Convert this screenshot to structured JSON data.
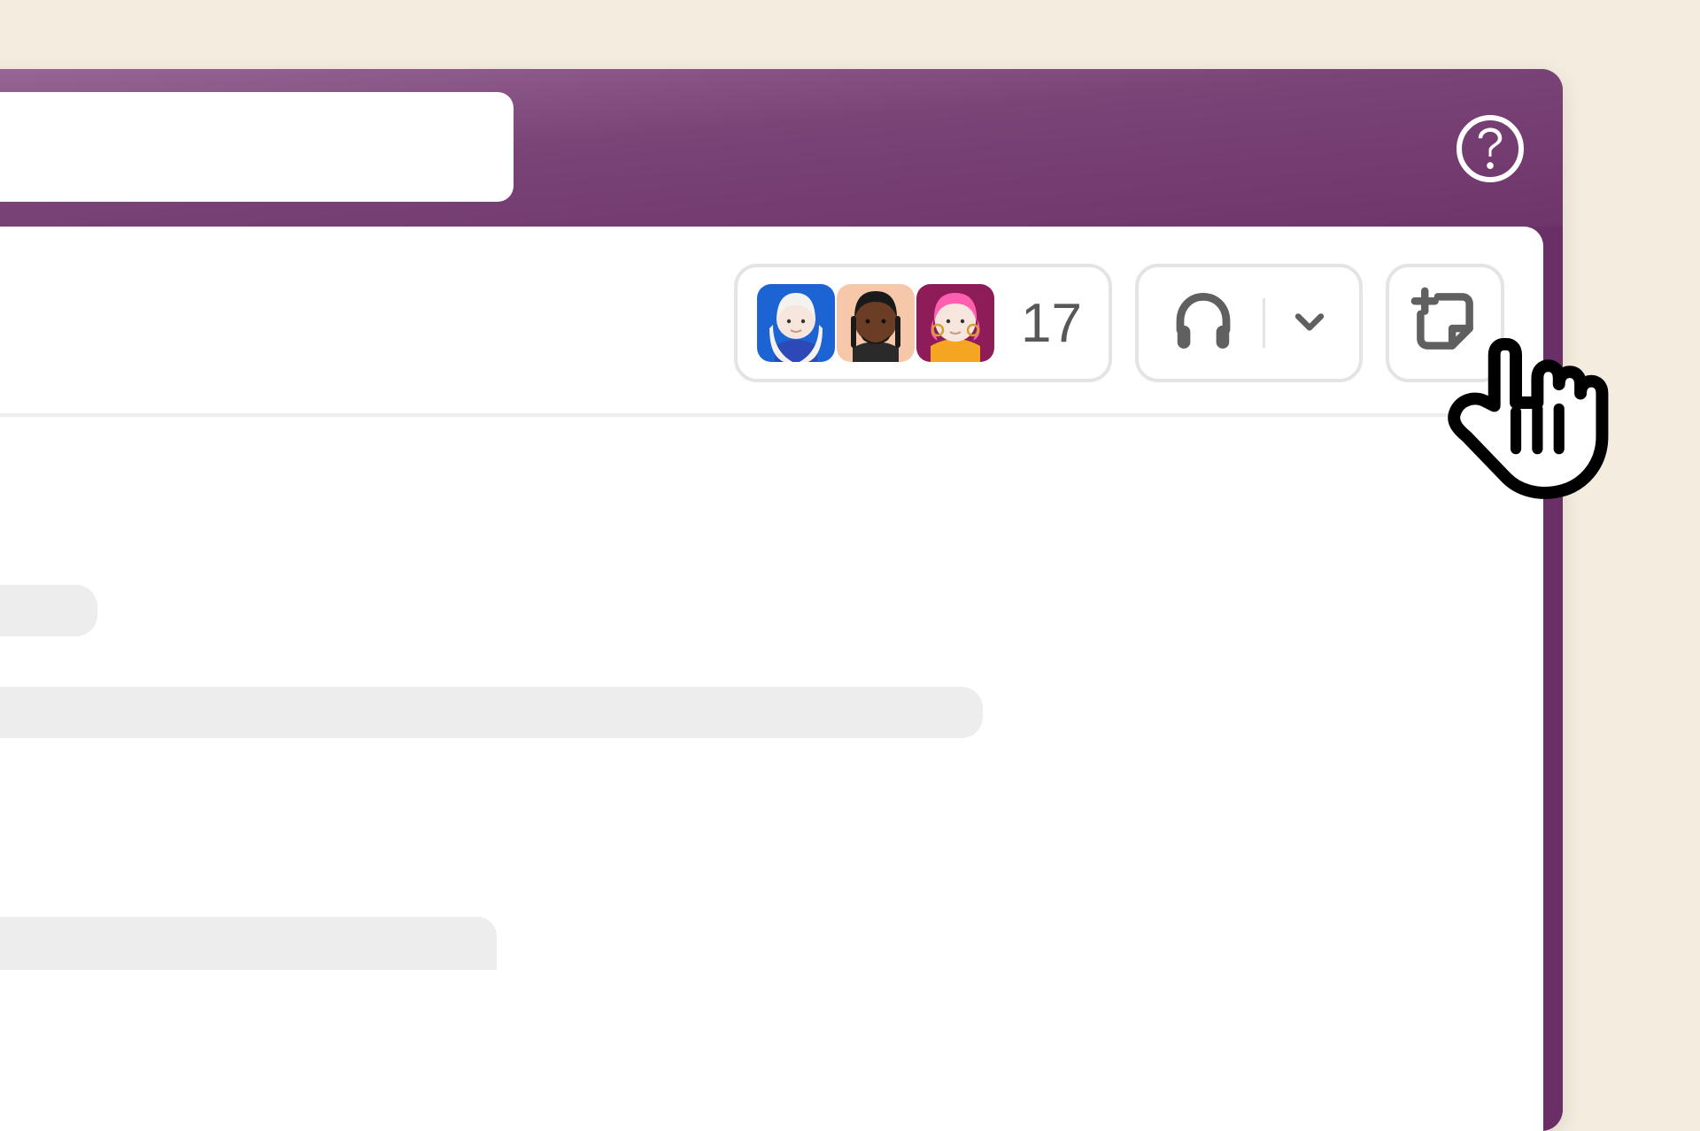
{
  "titlebar": {
    "search_value": "",
    "search_placeholder": "",
    "help_icon": "help-icon"
  },
  "channel_header": {
    "members": {
      "avatars": [
        {
          "name": "avatar-1",
          "bg": "#1c63d4",
          "skin": "#f6e6dd",
          "hair": "#f4f2ef",
          "shirt": "#2d49b8"
        },
        {
          "name": "avatar-2",
          "bg": "#f6c7a8",
          "skin": "#6a3d24",
          "hair": "#1a1a1a",
          "shirt": "#2a2a2a"
        },
        {
          "name": "avatar-3",
          "bg": "#8e1c58",
          "skin": "#f6e6dd",
          "hair": "#ff5fb0",
          "shirt": "#f4a623"
        }
      ],
      "count": "17"
    },
    "huddle": {
      "icon": "headphones-icon",
      "chevron": "chevron-down-icon"
    },
    "canvas": {
      "icon": "add-canvas-icon"
    }
  },
  "cursor": {
    "icon": "pointer-hand-cursor"
  },
  "colors": {
    "page_bg": "#f4ecde",
    "window_purple": "#6e356b",
    "border_gray": "#e4e4e4",
    "icon_gray": "#606060",
    "skeleton": "#ededed"
  }
}
